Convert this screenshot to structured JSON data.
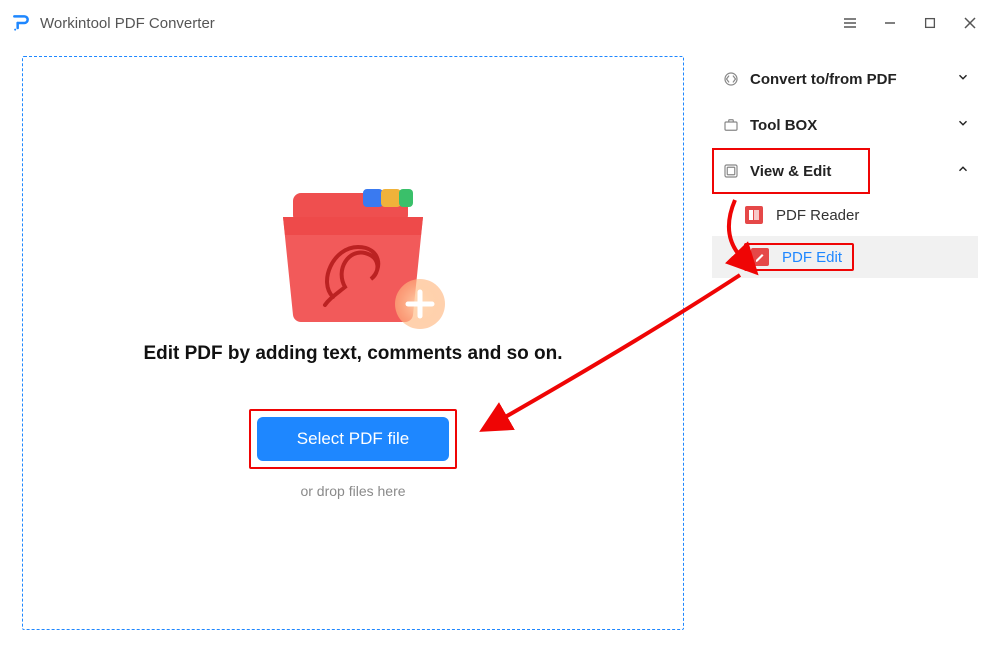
{
  "titlebar": {
    "app_title": "Workintool PDF Converter"
  },
  "main": {
    "instruction": "Edit PDF by adding text, comments and so on.",
    "select_button_label": "Select PDF file",
    "drop_hint": "or drop files here"
  },
  "sidebar": {
    "items": [
      {
        "label": "Convert to/from PDF",
        "expanded": false
      },
      {
        "label": "Tool BOX",
        "expanded": false
      },
      {
        "label": "View & Edit",
        "expanded": true,
        "children": [
          {
            "label": "PDF Reader",
            "active": false
          },
          {
            "label": "PDF Edit",
            "active": true
          }
        ]
      }
    ]
  },
  "annotation_color": "#ef0505"
}
